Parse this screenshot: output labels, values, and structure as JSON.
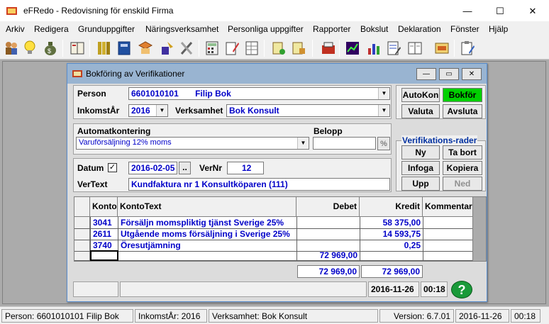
{
  "window": {
    "title": "eFRedo - Redovisning för enskild Firma",
    "minimize": "—",
    "maximize": "☐",
    "close": "✕"
  },
  "menu": [
    "Arkiv",
    "Redigera",
    "Grunduppgifter",
    "Näringsverksamhet",
    "Personliga uppgifter",
    "Rapporter",
    "Bokslut",
    "Deklaration",
    "Fönster",
    "Hjälp"
  ],
  "toolbar_icons": [
    "people-icon",
    "bulb-icon",
    "moneybag-icon",
    "book-icon",
    "ledger-icon",
    "binder-icon",
    "folder-arrow-icon",
    "paint-icon",
    "tools-icon",
    "calculator-icon",
    "document-edit-icon",
    "spreadsheet-icon",
    "tag-icon",
    "package-icon",
    "chart-line-icon",
    "bar-chart-icon",
    "report-icon",
    "open-book-icon",
    "stamp-icon",
    "receipt-icon"
  ],
  "child": {
    "title": "Bokföring av Verifikationer",
    "person_label": "Person",
    "person_id": "6601010101",
    "person_name": "Filip Bok",
    "inkomstar_label": "InkomstÅr",
    "inkomstar": "2016",
    "verksamhet_label": "Verksamhet",
    "verksamhet": "Bok Konsult",
    "autokontering_label": "Automatkontering",
    "autokontering": "Varuförsäljning 12% moms",
    "belopp_label": "Belopp",
    "belopp": "",
    "percent_label": "%",
    "datum_label": "Datum",
    "datum_checked": "✓",
    "datum": "2016-02-05",
    "datum_btn": "..",
    "vernr_label": "VerNr",
    "vernr": "12",
    "vertext_label": "VerText",
    "vertext": "Kundfaktura nr 1 Konsultköparen (111)",
    "buttons": {
      "autokon": "AutoKon",
      "bokfor": "Bokför",
      "valuta": "Valuta",
      "avsluta": "Avsluta"
    },
    "ver_rader_label": "Verifikations-rader",
    "rad_buttons": {
      "ny": "Ny",
      "ta_bort": "Ta bort",
      "infoga": "Infoga",
      "kopiera": "Kopiera",
      "upp": "Upp",
      "ned": "Ned"
    },
    "table": {
      "headers": {
        "konto": "Konto",
        "kontotext": "KontoText",
        "debet": "Debet",
        "kredit": "Kredit",
        "kommentar": "Kommentar"
      },
      "rows": [
        {
          "konto": "3041",
          "kontotext": "Försäljn momspliktig tjänst Sverige 25%",
          "debet": "",
          "kredit": "58 375,00",
          "kommentar": ""
        },
        {
          "konto": "2611",
          "kontotext": "Utgående moms försäljning i Sverige 25%",
          "debet": "",
          "kredit": "14 593,75",
          "kommentar": ""
        },
        {
          "konto": "3740",
          "kontotext": "Öresutjämning",
          "debet": "",
          "kredit": "0,25",
          "kommentar": ""
        },
        {
          "konto": "",
          "kontotext": "",
          "debet": "72 969,00",
          "kredit": "",
          "kommentar": ""
        }
      ]
    },
    "sum_debet": "72 969,00",
    "sum_kredit": "72 969,00",
    "status_date": "2016-11-26",
    "status_time": "00:18",
    "help": "?"
  },
  "statusbar": {
    "person": "Person: 6601010101  Filip Bok",
    "inkomstar": "InkomstÅr: 2016",
    "verksamhet": "Verksamhet: Bok Konsult",
    "version": "Version: 6.7.01",
    "date": "2016-11-26",
    "time": "00:18"
  },
  "colors": {
    "bokfor_bg": "#00d000",
    "accent": "#0000c8",
    "title_bg": "#99b4d1"
  }
}
